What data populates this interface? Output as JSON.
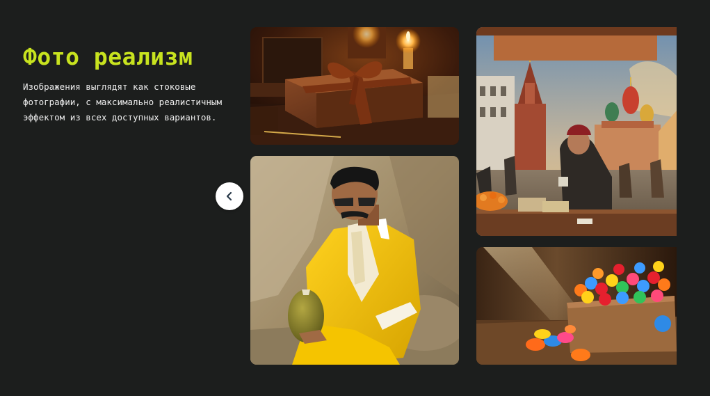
{
  "section": {
    "title": "Фото реализм",
    "description": "Изображения выглядят как стоковые фотографии, с максимально реалистичным эффектом из всех доступных вариантов."
  },
  "carousel": {
    "prev_icon": "chevron-left-icon",
    "images": [
      {
        "subject": "gift-box-candles",
        "alt": ""
      },
      {
        "subject": "man-yellow-suit",
        "alt": ""
      },
      {
        "subject": "red-square-market",
        "alt": ""
      },
      {
        "subject": "gummy-candies-box",
        "alt": ""
      }
    ]
  },
  "colors": {
    "background": "#1c1e1d",
    "accent": "#c8e31f",
    "text": "#eeeeee",
    "button_bg": "#ffffff"
  }
}
